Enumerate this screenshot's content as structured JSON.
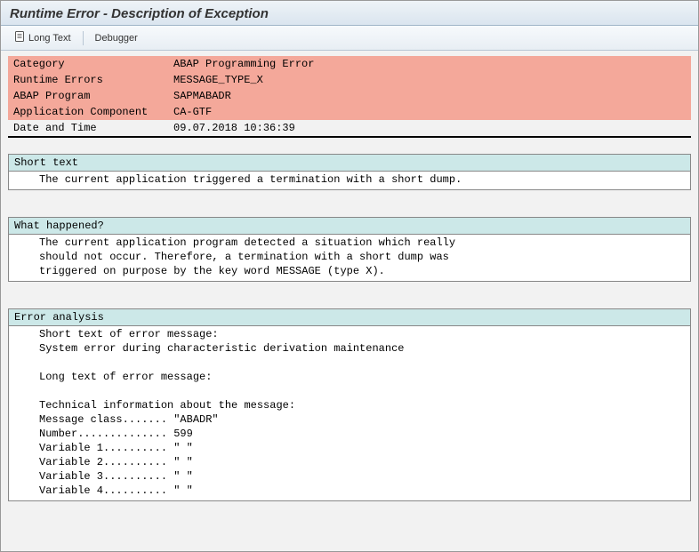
{
  "title": "Runtime Error - Description of Exception",
  "toolbar": {
    "long_text_label": "Long Text",
    "debugger_label": "Debugger"
  },
  "header": {
    "rows": [
      {
        "label": "Category",
        "value": "ABAP Programming Error",
        "red": true
      },
      {
        "label": "Runtime Errors",
        "value": "MESSAGE_TYPE_X",
        "red": true
      },
      {
        "label": "ABAP Program",
        "value": "SAPMABADR",
        "red": true
      },
      {
        "label": "Application Component",
        "value": "CA-GTF",
        "red": true
      },
      {
        "label": "Date and Time",
        "value": "09.07.2018 10:36:39",
        "red": false
      }
    ]
  },
  "sections": {
    "short_text": {
      "title": "Short text",
      "lines": [
        "The current application triggered a termination with a short dump."
      ]
    },
    "what_happened": {
      "title": "What happened?",
      "lines": [
        "The current application program detected a situation which really",
        "should not occur. Therefore, a termination with a short dump was",
        "triggered on purpose by the key word MESSAGE (type X)."
      ]
    },
    "error_analysis": {
      "title": "Error analysis",
      "lines": [
        "Short text of error message:",
        "System error during characteristic derivation maintenance",
        "",
        "Long text of error message:",
        "",
        "Technical information about the message:",
        "Message class....... \"ABADR\"",
        "Number.............. 599",
        "Variable 1.......... \" \"",
        "Variable 2.......... \" \"",
        "Variable 3.......... \" \"",
        "Variable 4.......... \" \""
      ]
    }
  }
}
